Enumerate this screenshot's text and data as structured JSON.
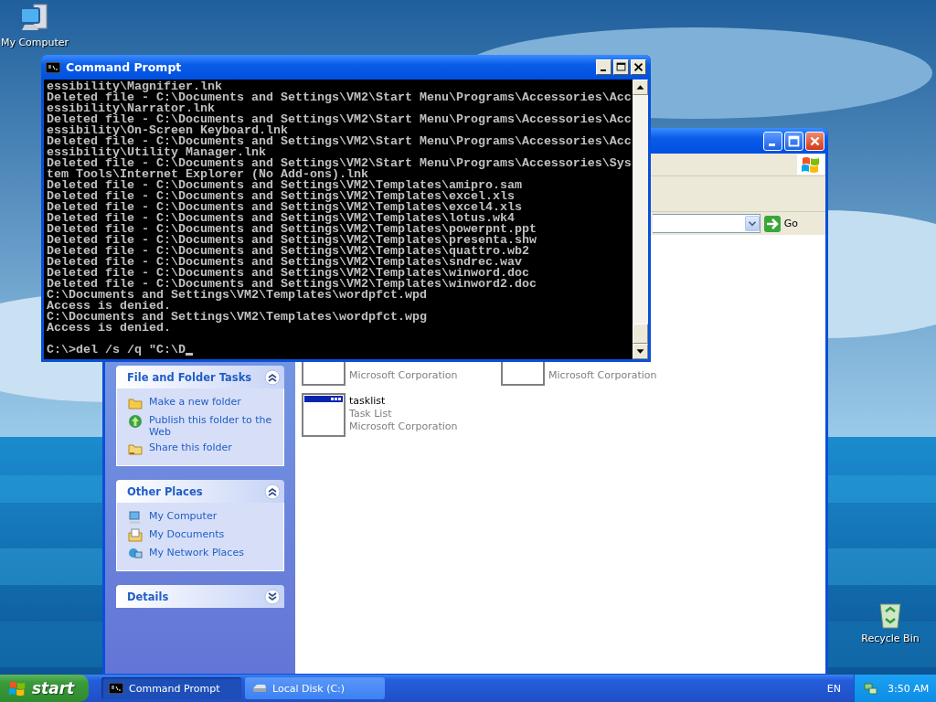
{
  "desktop_icons": [
    {
      "label": "My Computer",
      "kind": "computer"
    },
    {
      "label": "Recycle Bin",
      "kind": "recycle_bin"
    }
  ],
  "explorer": {
    "go_button": "Go",
    "panes": [
      {
        "title": "File and Folder Tasks",
        "expanded": true,
        "items": [
          {
            "label": "Make a new folder",
            "kind": "new_folder"
          },
          {
            "label": "Publish this folder to the Web",
            "kind": "publish"
          },
          {
            "label": "Share this folder",
            "kind": "share"
          }
        ]
      },
      {
        "title": "Other Places",
        "expanded": true,
        "items": [
          {
            "label": "My Computer",
            "kind": "computer"
          },
          {
            "label": "My Documents",
            "kind": "documents"
          },
          {
            "label": "My Network Places",
            "kind": "network"
          }
        ]
      },
      {
        "title": "Details",
        "expanded": false
      }
    ],
    "files": [
      {
        "company": "Microsoft Corporation"
      },
      {
        "company": "Microsoft Corporation"
      },
      {
        "name": "tasklist",
        "type": "Task List",
        "company": "Microsoft Corporation"
      }
    ]
  },
  "console": {
    "title": "Command Prompt",
    "lines": [
      "essibility\\Magnifier.lnk",
      "Deleted file - C:\\Documents and Settings\\VM2\\Start Menu\\Programs\\Accessories\\Acc",
      "essibility\\Narrator.lnk",
      "Deleted file - C:\\Documents and Settings\\VM2\\Start Menu\\Programs\\Accessories\\Acc",
      "essibility\\On-Screen Keyboard.lnk",
      "Deleted file - C:\\Documents and Settings\\VM2\\Start Menu\\Programs\\Accessories\\Acc",
      "essibility\\Utility Manager.lnk",
      "Deleted file - C:\\Documents and Settings\\VM2\\Start Menu\\Programs\\Accessories\\Sys",
      "tem Tools\\Internet Explorer (No Add-ons).lnk",
      "Deleted file - C:\\Documents and Settings\\VM2\\Templates\\amipro.sam",
      "Deleted file - C:\\Documents and Settings\\VM2\\Templates\\excel.xls",
      "Deleted file - C:\\Documents and Settings\\VM2\\Templates\\excel4.xls",
      "Deleted file - C:\\Documents and Settings\\VM2\\Templates\\lotus.wk4",
      "Deleted file - C:\\Documents and Settings\\VM2\\Templates\\powerpnt.ppt",
      "Deleted file - C:\\Documents and Settings\\VM2\\Templates\\presenta.shw",
      "Deleted file - C:\\Documents and Settings\\VM2\\Templates\\quattro.wb2",
      "Deleted file - C:\\Documents and Settings\\VM2\\Templates\\sndrec.wav",
      "Deleted file - C:\\Documents and Settings\\VM2\\Templates\\winword.doc",
      "Deleted file - C:\\Documents and Settings\\VM2\\Templates\\winword2.doc",
      "C:\\Documents and Settings\\VM2\\Templates\\wordpfct.wpd",
      "Access is denied.",
      "C:\\Documents and Settings\\VM2\\Templates\\wordpfct.wpg",
      "Access is denied."
    ],
    "prompt": "C:\\>del /s /q \"C:\\D"
  },
  "taskbar": {
    "start": "start",
    "tasks": [
      {
        "label": "Command Prompt",
        "selected": true,
        "kind": "console"
      },
      {
        "label": "Local Disk (C:)",
        "selected": false,
        "kind": "drive"
      }
    ],
    "language": "EN",
    "clock": "3:50 AM"
  }
}
